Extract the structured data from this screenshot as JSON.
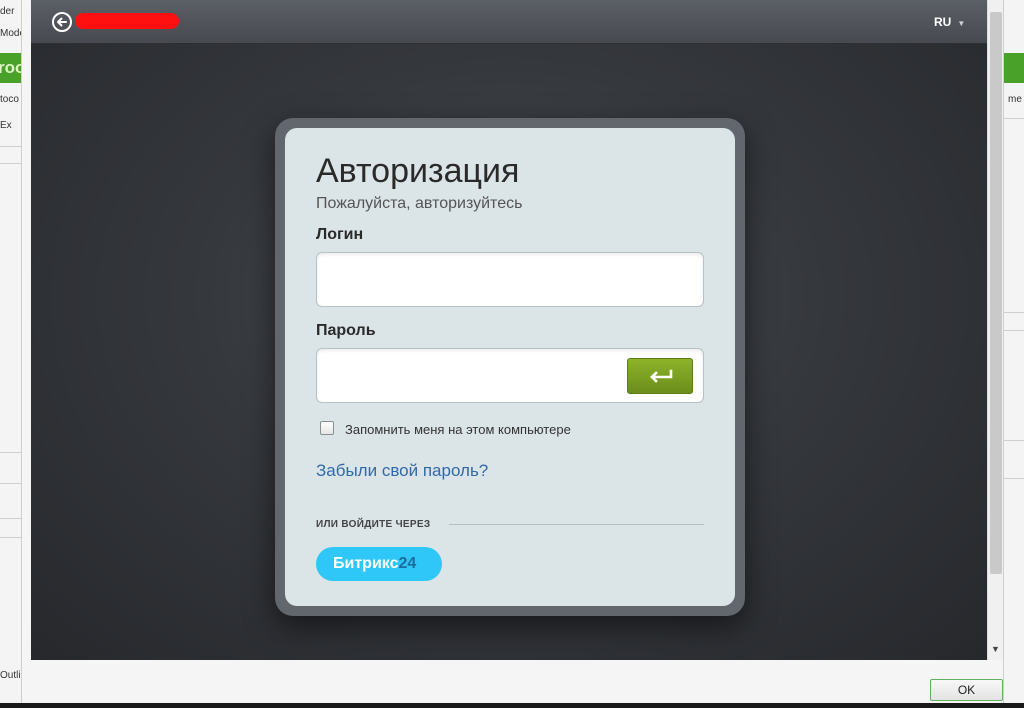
{
  "background_app": {
    "left_texts": [
      "der",
      "Mode",
      "roo",
      "toco",
      "Ex",
      "Outli"
    ],
    "right_texts": [
      "me"
    ]
  },
  "dialog": {
    "topbar": {
      "back_icon": "arrow-left-circle-icon",
      "language": "RU"
    },
    "login_form": {
      "title": "Авторизация",
      "subtitle": "Пожалуйста, авторизуйтесь",
      "login_label": "Логин",
      "login_value": "",
      "password_label": "Пароль",
      "password_value": "",
      "enter_icon": "enter-arrow-icon",
      "remember_label": "Запомнить меня на этом компьютере",
      "remember_checked": false,
      "forgot_link": "Забыли свой пароль?",
      "or_login_via": "ИЛИ ВОЙДИТЕ ЧЕРЕЗ",
      "bitrix_name": "Битрикс",
      "bitrix_number": "24"
    },
    "ok_button": "OK"
  },
  "colors": {
    "accent_green": "#7aa020",
    "bitrix_blue": "#2fc7f7",
    "link_blue": "#2f6aa8",
    "card_bg": "#dbe4e7"
  }
}
